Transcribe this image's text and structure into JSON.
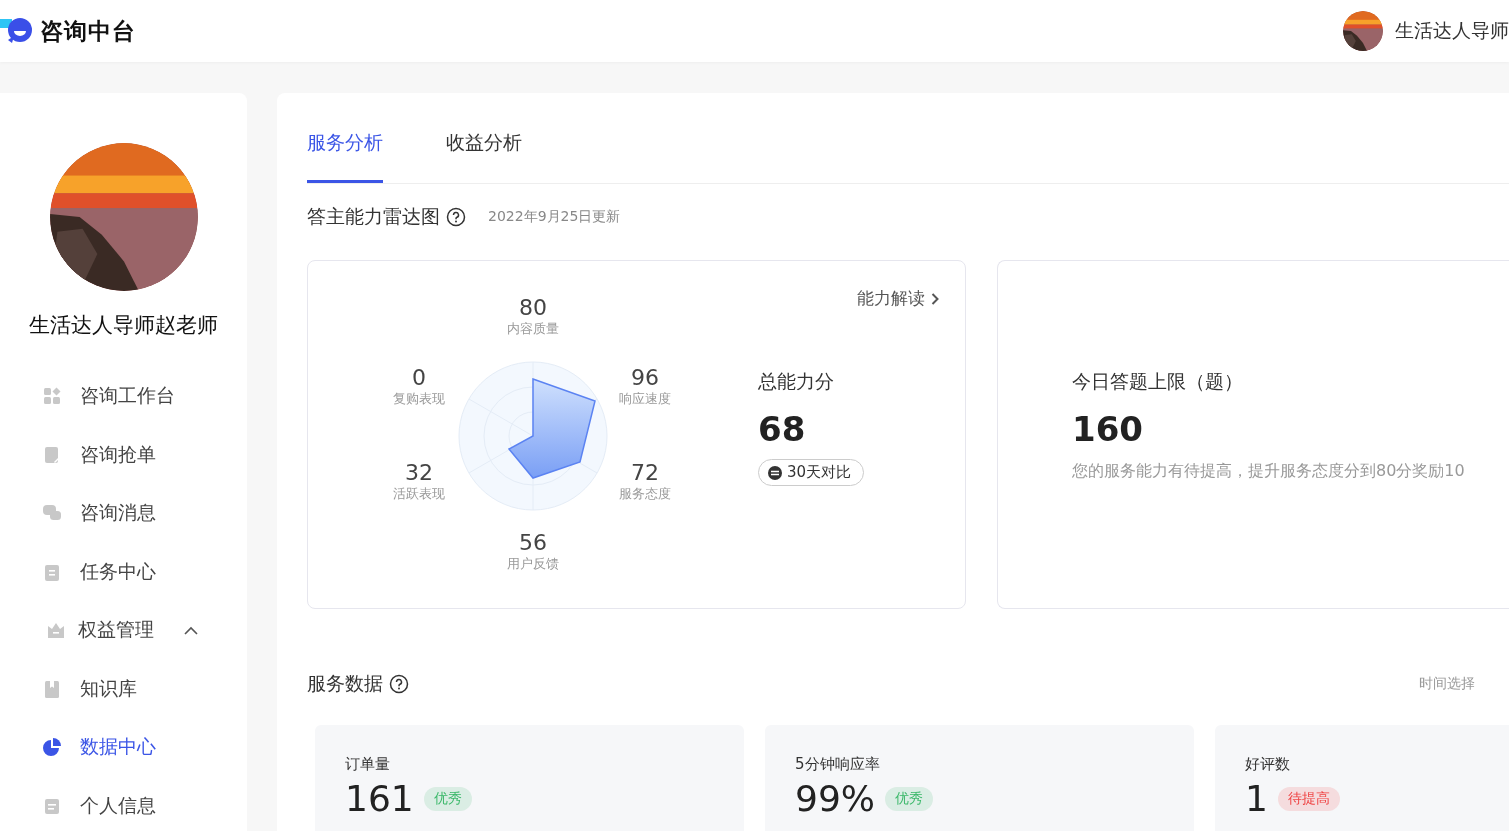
{
  "header": {
    "app_name": "咨询中台",
    "user_name": "生活达人导师"
  },
  "sidebar": {
    "profile_name": "生活达人导师赵老师",
    "items": [
      {
        "label": "咨询工作台",
        "kind": "link",
        "selected": false
      },
      {
        "label": "咨询抢单",
        "kind": "link",
        "selected": false
      },
      {
        "label": "咨询消息",
        "kind": "link",
        "selected": false
      },
      {
        "label": "任务中心",
        "kind": "link",
        "selected": false
      },
      {
        "label": "权益管理",
        "kind": "group",
        "expanded": true,
        "selected": false
      },
      {
        "label": "知识库",
        "kind": "link",
        "selected": false
      },
      {
        "label": "数据中心",
        "kind": "link",
        "selected": true
      },
      {
        "label": "个人信息",
        "kind": "link",
        "selected": false
      }
    ]
  },
  "tabs": [
    {
      "label": "服务分析",
      "selected": true
    },
    {
      "label": "收益分析",
      "selected": false
    }
  ],
  "radar_section": {
    "title": "答主能力雷达图",
    "updated": "2022年9月25日更新",
    "axes": [
      {
        "value": "80",
        "label": "内容质量"
      },
      {
        "value": "0",
        "label": "复购表现"
      },
      {
        "value": "96",
        "label": "响应速度"
      },
      {
        "value": "32",
        "label": "活跃表现"
      },
      {
        "value": "72",
        "label": "服务态度"
      },
      {
        "value": "56",
        "label": "用户反馈"
      }
    ],
    "link": "能力解读",
    "score_label": "总能力分",
    "score": "68",
    "compare_button": "30天对比"
  },
  "limit_card": {
    "title": "今日答题上限（题）",
    "value": "160",
    "note": "您的服务能力有待提高，提升服务态度分到80分奖励10"
  },
  "service_data": {
    "title": "服务数据",
    "time_select": "时间选择",
    "stats": [
      {
        "label": "订单量",
        "value": "161",
        "badge": "优秀",
        "color": "#3bb86a"
      },
      {
        "label": "5分钟响应率",
        "value": "99%",
        "badge": "优秀",
        "color": "#3bb86a"
      },
      {
        "label": "好评数",
        "value": "1",
        "badge": "待提高",
        "color": "#ef4444"
      }
    ]
  }
}
